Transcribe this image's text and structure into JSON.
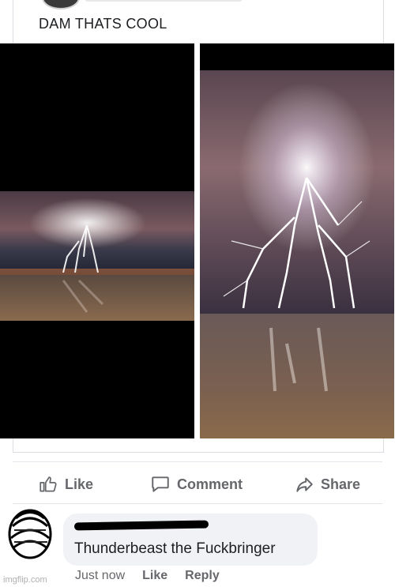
{
  "post": {
    "text": "DAM THATS COOL"
  },
  "actions": {
    "like": "Like",
    "comment": "Comment",
    "share": "Share"
  },
  "comment": {
    "text": "Thunderbeast the Fuckbringer",
    "time": "Just now",
    "like": "Like",
    "reply": "Reply"
  },
  "watermark": "imgflip.com",
  "colors": {
    "action_gray": "#65676b",
    "bubble_bg": "#f0f2f5",
    "divider": "#e4e6eb"
  },
  "icons": {
    "like": "thumbs-up-icon",
    "comment": "speech-bubble-icon",
    "share": "share-arrow-icon"
  }
}
